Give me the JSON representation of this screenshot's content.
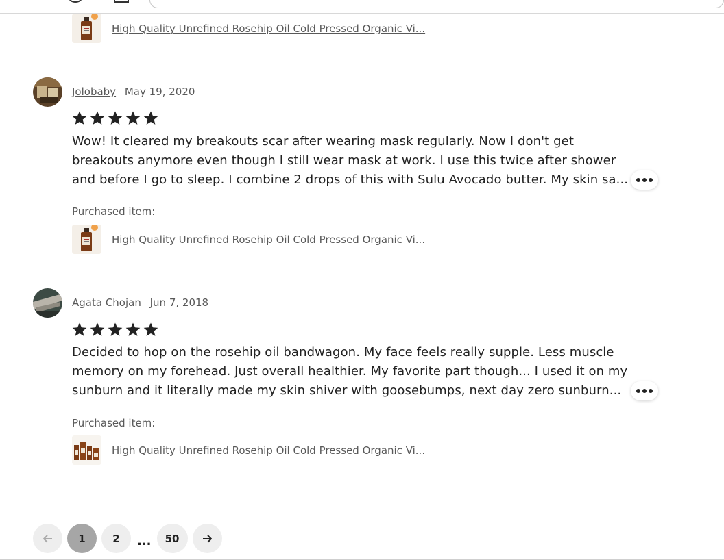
{
  "reviews": [
    {
      "purchased_item": "High Quality Unrefined Rosehip Oil Cold Pressed Organic Vi..."
    },
    {
      "user": "Jolobaby",
      "date": "May 19, 2020",
      "rating": 5,
      "lines": [
        "Wow! It cleared my breakouts scar after wearing mask regularly. Now I don't get",
        "breakouts anymore even though I still wear mask at work. I use this twice after shower",
        "and before I go to sleep. I combine 2 drops of this with Sulu Avocado butter. My skin sa..."
      ],
      "purchased_label": "Purchased item:",
      "purchased_item": "High Quality Unrefined Rosehip Oil Cold Pressed Organic Vi..."
    },
    {
      "user": "Agata Chojan",
      "date": "Jun 7, 2018",
      "rating": 5,
      "lines": [
        "Decided to hop on the rosehip oil bandwagon. My face feels really supple. Less muscle",
        "memory on my forehead. Just overall healthier. My favorite part though... I used it on my",
        "sunburn and it literally made my skin shiver with goosebumps, next day zero sunburn..."
      ],
      "purchased_label": "Purchased item:",
      "purchased_item": "High Quality Unrefined Rosehip Oil Cold Pressed Organic Vi..."
    }
  ],
  "pagination": {
    "prev_icon": "arrow-left-icon",
    "pages": [
      "1",
      "2"
    ],
    "ellipsis": "...",
    "last": "50",
    "next_icon": "arrow-right-icon",
    "current": "1"
  },
  "colors": {
    "text": "#222222",
    "muted": "#595959",
    "pager_bg": "#eeeeee",
    "pager_active": "#a6a6a6"
  }
}
